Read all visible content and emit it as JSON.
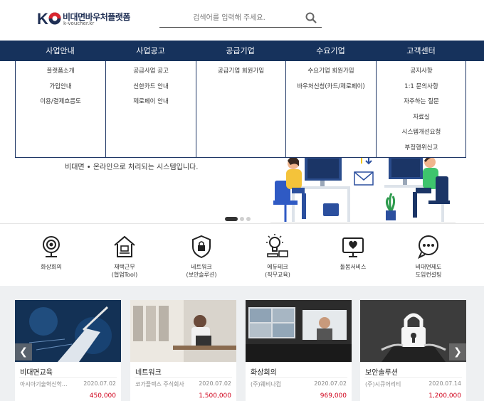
{
  "header": {
    "logo_name": "비대면바우처플랫폼",
    "logo_sub": "k-voucher.kr",
    "search_placeholder": "검색어를 입력해 주세요."
  },
  "nav": {
    "items": [
      {
        "label": "사업안내"
      },
      {
        "label": "사업공고"
      },
      {
        "label": "공급기업"
      },
      {
        "label": "수요기업"
      },
      {
        "label": "고객센터"
      }
    ]
  },
  "dropdown": {
    "columns": [
      {
        "items": [
          "플랫폼소개",
          "가입안내",
          "이용/결제흐름도"
        ]
      },
      {
        "items": [
          "공급사업 공고",
          "신한카드 안내",
          "제로페이 안내"
        ]
      },
      {
        "items": [
          "공급기업 회원가입"
        ]
      },
      {
        "items": [
          "수요기업 회원가입",
          "바우처신청(카드/제로페이)"
        ]
      },
      {
        "items": [
          "공지사항",
          "1:1 문의사항",
          "자주하는 질문",
          "자료실",
          "시스템개선요청",
          "부정행위신고"
        ]
      }
    ]
  },
  "hero": {
    "text": "비대면 • 온라인으로 처리되는 시스템입니다.",
    "slides": 3,
    "active_slide": 1
  },
  "services": [
    {
      "label": "화상회의",
      "icon": "webcam-icon"
    },
    {
      "label": "재택근무\n(협업Tool)",
      "icon": "home-work-icon"
    },
    {
      "label": "네트워크\n(보안솔루션)",
      "icon": "shield-lock-icon"
    },
    {
      "label": "에듀테크\n(직무교육)",
      "icon": "lightbulb-edu-icon"
    },
    {
      "label": "돌봄서비스",
      "icon": "care-monitor-icon"
    },
    {
      "label": "비대면제도\n도입컨설팅",
      "icon": "chat-bubble-icon"
    }
  ],
  "cards": [
    {
      "title": "비대면교육",
      "company": "아시아기술혁신학...",
      "date": "2020.07.02",
      "price": "450,000",
      "image": "education-image"
    },
    {
      "title": "네트워크",
      "company": "코가플렉스 주식회사",
      "date": "2020.07.02",
      "price": "1,500,000",
      "image": "network-image"
    },
    {
      "title": "화상회의",
      "company": "(주)웨비나컴",
      "date": "2020.07.02",
      "price": "969,000",
      "image": "video-meeting-image"
    },
    {
      "title": "보안솔루션",
      "company": "(주)시큐어리티",
      "date": "2020.07.14",
      "price": "1,200,000",
      "image": "security-image"
    }
  ],
  "colors": {
    "nav_bg": "#16325c",
    "price_red": "#d0021b",
    "logo_red": "#d8262f",
    "logo_navy": "#1f2f54"
  }
}
